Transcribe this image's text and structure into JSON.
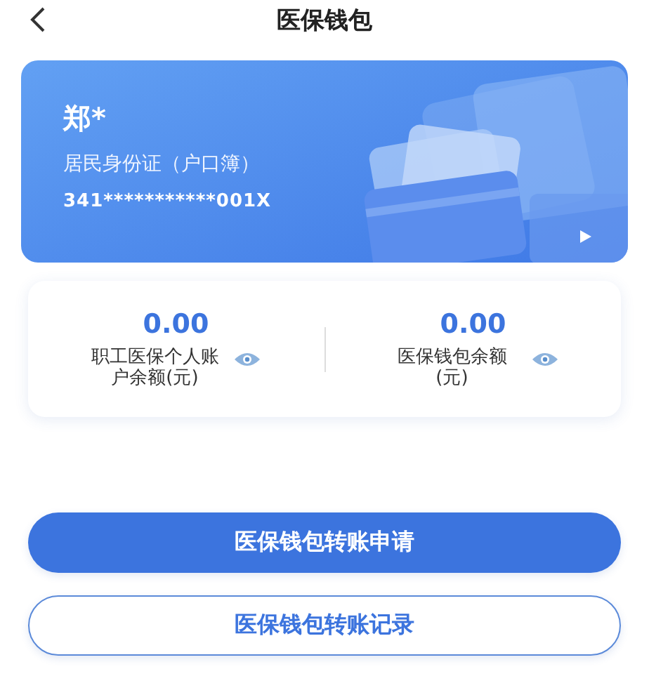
{
  "header": {
    "title": "医保钱包"
  },
  "card": {
    "name": "郑*",
    "id_type": "居民身份证（户口簿）",
    "id_number": "341***********001X"
  },
  "balances": [
    {
      "amount": "0.00",
      "label": "职工医保个人账户余额(元)"
    },
    {
      "amount": "0.00",
      "label": "医保钱包余额(元)"
    }
  ],
  "buttons": [
    {
      "label": "医保钱包转账申请",
      "kind": "primary"
    },
    {
      "label": "医保钱包转账记录",
      "kind": "outline"
    }
  ]
}
